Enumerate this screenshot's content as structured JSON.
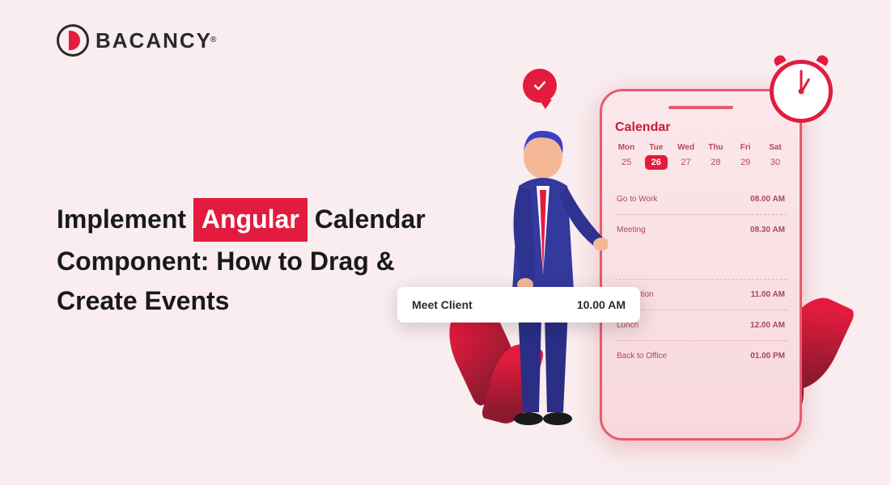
{
  "logo_text": "BACANCY",
  "logo_reg": "®",
  "headline": {
    "p1": "Implement",
    "tag": "Angular",
    "p2": "Calendar",
    "line2": "Component: How to Drag &",
    "line3": "Create Events"
  },
  "calendar": {
    "title": "Calendar",
    "days": [
      "Mon",
      "Tue",
      "Wed",
      "Thu",
      "Fri",
      "Sat"
    ],
    "dates": [
      "25",
      "26",
      "27",
      "28",
      "29",
      "30"
    ],
    "selected_index": 1,
    "events": [
      {
        "label": "Go to Work",
        "time": "08.00 AM"
      },
      {
        "label": "Meeting",
        "time": "08.30 AM"
      },
      {
        "label": "Inspection",
        "time": "11.00 AM"
      },
      {
        "label": "Lunch",
        "time": "12.00 AM"
      },
      {
        "label": "Back to Office",
        "time": "01.00 PM"
      }
    ]
  },
  "floating_event": {
    "label": "Meet Client",
    "time": "10.00 AM"
  },
  "colors": {
    "accent": "#e31b3e",
    "bg": "#f9edef"
  }
}
